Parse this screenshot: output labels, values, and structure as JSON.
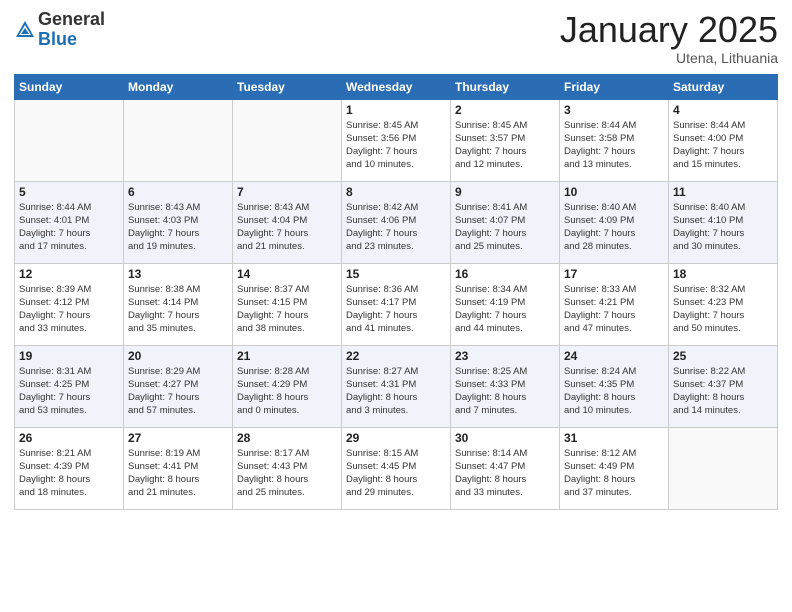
{
  "logo": {
    "general": "General",
    "blue": "Blue"
  },
  "title": "January 2025",
  "subtitle": "Utena, Lithuania",
  "days_header": [
    "Sunday",
    "Monday",
    "Tuesday",
    "Wednesday",
    "Thursday",
    "Friday",
    "Saturday"
  ],
  "weeks": [
    [
      {
        "num": "",
        "info": ""
      },
      {
        "num": "",
        "info": ""
      },
      {
        "num": "",
        "info": ""
      },
      {
        "num": "1",
        "info": "Sunrise: 8:45 AM\nSunset: 3:56 PM\nDaylight: 7 hours\nand 10 minutes."
      },
      {
        "num": "2",
        "info": "Sunrise: 8:45 AM\nSunset: 3:57 PM\nDaylight: 7 hours\nand 12 minutes."
      },
      {
        "num": "3",
        "info": "Sunrise: 8:44 AM\nSunset: 3:58 PM\nDaylight: 7 hours\nand 13 minutes."
      },
      {
        "num": "4",
        "info": "Sunrise: 8:44 AM\nSunset: 4:00 PM\nDaylight: 7 hours\nand 15 minutes."
      }
    ],
    [
      {
        "num": "5",
        "info": "Sunrise: 8:44 AM\nSunset: 4:01 PM\nDaylight: 7 hours\nand 17 minutes."
      },
      {
        "num": "6",
        "info": "Sunrise: 8:43 AM\nSunset: 4:03 PM\nDaylight: 7 hours\nand 19 minutes."
      },
      {
        "num": "7",
        "info": "Sunrise: 8:43 AM\nSunset: 4:04 PM\nDaylight: 7 hours\nand 21 minutes."
      },
      {
        "num": "8",
        "info": "Sunrise: 8:42 AM\nSunset: 4:06 PM\nDaylight: 7 hours\nand 23 minutes."
      },
      {
        "num": "9",
        "info": "Sunrise: 8:41 AM\nSunset: 4:07 PM\nDaylight: 7 hours\nand 25 minutes."
      },
      {
        "num": "10",
        "info": "Sunrise: 8:40 AM\nSunset: 4:09 PM\nDaylight: 7 hours\nand 28 minutes."
      },
      {
        "num": "11",
        "info": "Sunrise: 8:40 AM\nSunset: 4:10 PM\nDaylight: 7 hours\nand 30 minutes."
      }
    ],
    [
      {
        "num": "12",
        "info": "Sunrise: 8:39 AM\nSunset: 4:12 PM\nDaylight: 7 hours\nand 33 minutes."
      },
      {
        "num": "13",
        "info": "Sunrise: 8:38 AM\nSunset: 4:14 PM\nDaylight: 7 hours\nand 35 minutes."
      },
      {
        "num": "14",
        "info": "Sunrise: 8:37 AM\nSunset: 4:15 PM\nDaylight: 7 hours\nand 38 minutes."
      },
      {
        "num": "15",
        "info": "Sunrise: 8:36 AM\nSunset: 4:17 PM\nDaylight: 7 hours\nand 41 minutes."
      },
      {
        "num": "16",
        "info": "Sunrise: 8:34 AM\nSunset: 4:19 PM\nDaylight: 7 hours\nand 44 minutes."
      },
      {
        "num": "17",
        "info": "Sunrise: 8:33 AM\nSunset: 4:21 PM\nDaylight: 7 hours\nand 47 minutes."
      },
      {
        "num": "18",
        "info": "Sunrise: 8:32 AM\nSunset: 4:23 PM\nDaylight: 7 hours\nand 50 minutes."
      }
    ],
    [
      {
        "num": "19",
        "info": "Sunrise: 8:31 AM\nSunset: 4:25 PM\nDaylight: 7 hours\nand 53 minutes."
      },
      {
        "num": "20",
        "info": "Sunrise: 8:29 AM\nSunset: 4:27 PM\nDaylight: 7 hours\nand 57 minutes."
      },
      {
        "num": "21",
        "info": "Sunrise: 8:28 AM\nSunset: 4:29 PM\nDaylight: 8 hours\nand 0 minutes."
      },
      {
        "num": "22",
        "info": "Sunrise: 8:27 AM\nSunset: 4:31 PM\nDaylight: 8 hours\nand 3 minutes."
      },
      {
        "num": "23",
        "info": "Sunrise: 8:25 AM\nSunset: 4:33 PM\nDaylight: 8 hours\nand 7 minutes."
      },
      {
        "num": "24",
        "info": "Sunrise: 8:24 AM\nSunset: 4:35 PM\nDaylight: 8 hours\nand 10 minutes."
      },
      {
        "num": "25",
        "info": "Sunrise: 8:22 AM\nSunset: 4:37 PM\nDaylight: 8 hours\nand 14 minutes."
      }
    ],
    [
      {
        "num": "26",
        "info": "Sunrise: 8:21 AM\nSunset: 4:39 PM\nDaylight: 8 hours\nand 18 minutes."
      },
      {
        "num": "27",
        "info": "Sunrise: 8:19 AM\nSunset: 4:41 PM\nDaylight: 8 hours\nand 21 minutes."
      },
      {
        "num": "28",
        "info": "Sunrise: 8:17 AM\nSunset: 4:43 PM\nDaylight: 8 hours\nand 25 minutes."
      },
      {
        "num": "29",
        "info": "Sunrise: 8:15 AM\nSunset: 4:45 PM\nDaylight: 8 hours\nand 29 minutes."
      },
      {
        "num": "30",
        "info": "Sunrise: 8:14 AM\nSunset: 4:47 PM\nDaylight: 8 hours\nand 33 minutes."
      },
      {
        "num": "31",
        "info": "Sunrise: 8:12 AM\nSunset: 4:49 PM\nDaylight: 8 hours\nand 37 minutes."
      },
      {
        "num": "",
        "info": ""
      }
    ]
  ]
}
